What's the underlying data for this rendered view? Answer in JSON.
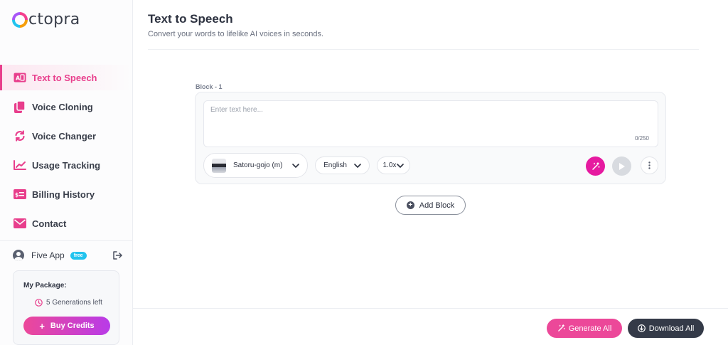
{
  "brand": {
    "logo_text": "ctopra"
  },
  "colors": {
    "accent": "#e83e8c",
    "magenta": "#e61aa0",
    "dark_button": "#343a48",
    "badge": "#22c3ee"
  },
  "sidebar": {
    "items": [
      {
        "label": "Text to Speech",
        "icon": "text-to-speech-icon",
        "active": true
      },
      {
        "label": "Voice Cloning",
        "icon": "copy-icon",
        "active": false
      },
      {
        "label": "Voice Changer",
        "icon": "refresh-icon",
        "active": false
      },
      {
        "label": "Usage Tracking",
        "icon": "chart-line-icon",
        "active": false
      },
      {
        "label": "Billing History",
        "icon": "billing-icon",
        "active": false
      },
      {
        "label": "Contact",
        "icon": "envelope-icon",
        "active": false
      }
    ],
    "user": {
      "name": "Five App",
      "plan_badge": "free"
    },
    "package": {
      "title": "My Package:",
      "generations_left": "5 Generations left",
      "buy_label": "Buy Credits"
    }
  },
  "header": {
    "title": "Text to Speech",
    "subtitle": "Convert your words to lifelike AI voices in seconds."
  },
  "block": {
    "label": "Block - 1",
    "text_placeholder": "Enter text here...",
    "text_value": "",
    "counter": "0/250",
    "voice": "Satoru-gojo (m)",
    "language": "English",
    "speed": "1.0x"
  },
  "add_block_label": "Add Block",
  "footer": {
    "generate_all_label": "Generate All",
    "download_all_label": "Download All"
  }
}
